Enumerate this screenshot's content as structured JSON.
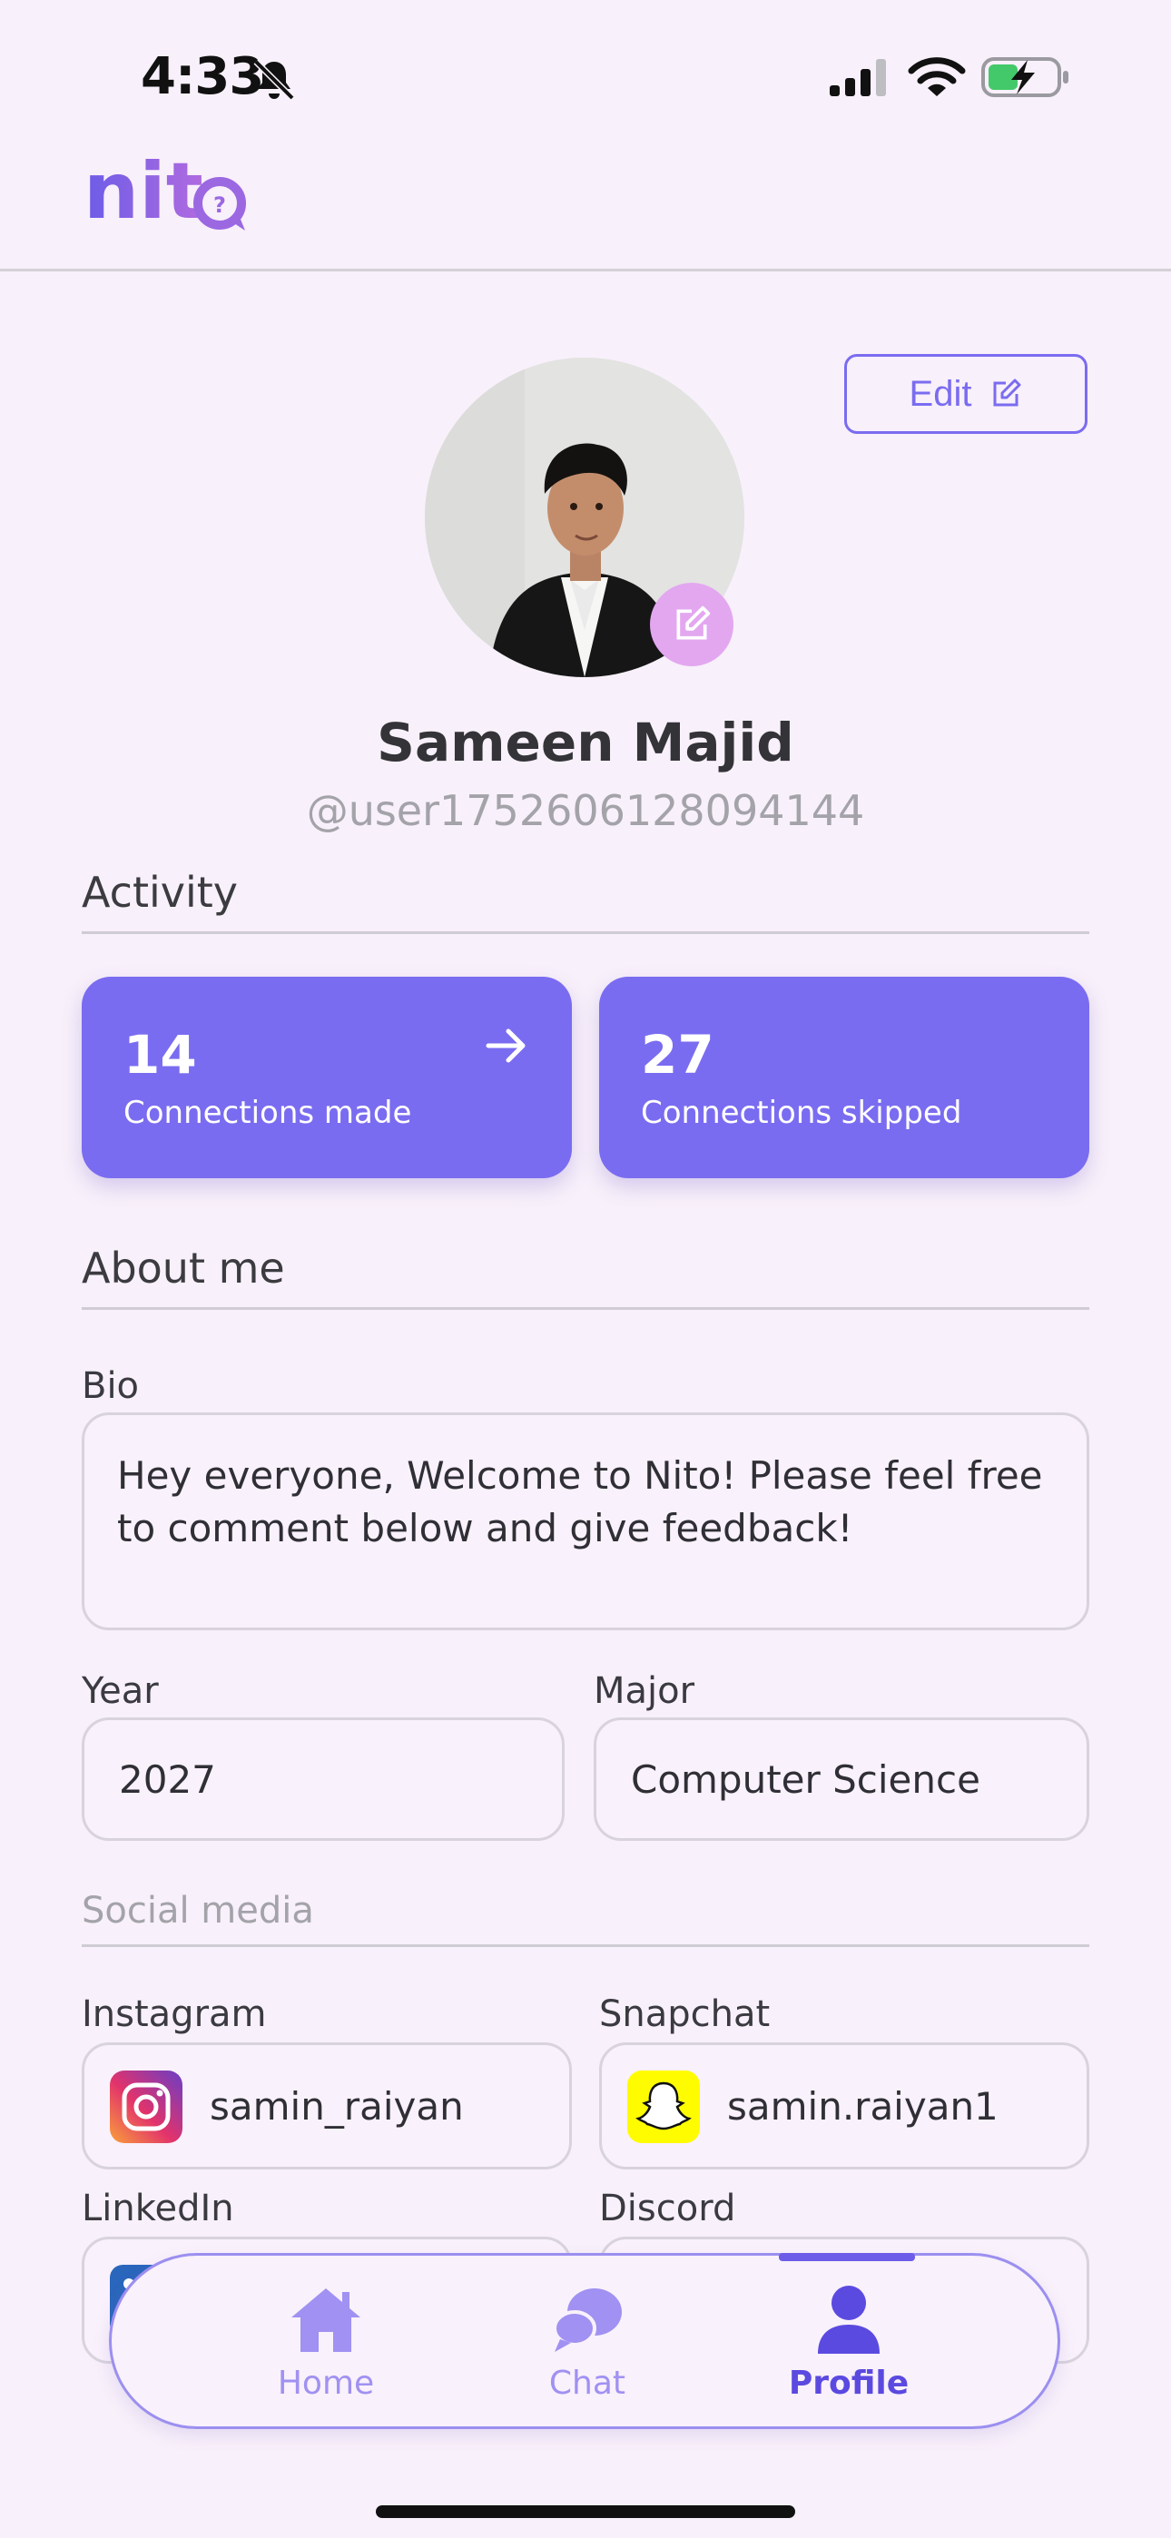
{
  "status_bar": {
    "time": "4:33"
  },
  "header": {
    "logo_text": "nito"
  },
  "profile": {
    "edit_label": "Edit",
    "name": "Sameen Majid",
    "handle": "@user1752606128094144"
  },
  "activity": {
    "title": "Activity",
    "cards": [
      {
        "value": "14",
        "label": "Connections made"
      },
      {
        "value": "27",
        "label": "Connections skipped"
      }
    ]
  },
  "about": {
    "title": "About me",
    "bio_label": "Bio",
    "bio": "Hey everyone, Welcome to Nito! Please feel free to comment below and give feedback!",
    "year_label": "Year",
    "year": "2027",
    "major_label": "Major",
    "major": "Computer Science"
  },
  "social": {
    "title": "Social media",
    "instagram_label": "Instagram",
    "instagram": "samin_raiyan",
    "snapchat_label": "Snapchat",
    "snapchat": "samin.raiyan1",
    "linkedin_label": "LinkedIn",
    "discord_label": "Discord"
  },
  "nav": {
    "items": [
      {
        "label": "Home",
        "icon": "home-icon",
        "active": false
      },
      {
        "label": "Chat",
        "icon": "chat-icon",
        "active": false
      },
      {
        "label": "Profile",
        "icon": "profile-icon",
        "active": true
      }
    ]
  },
  "colors": {
    "accent": "#7a6cf0",
    "background": "#f8f0fa",
    "avatar_edit": "#e3a7f0"
  }
}
